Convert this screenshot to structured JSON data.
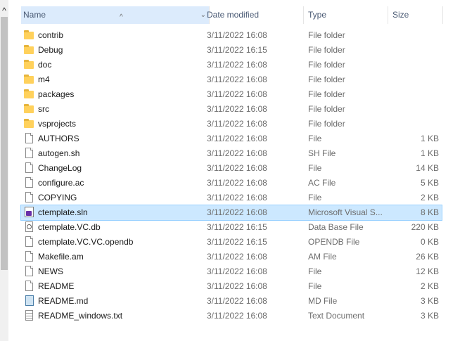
{
  "icons": {
    "scroll_up": "chevron-up-icon",
    "sort": "sort-ascending-icon",
    "column_menu": "chevron-down-icon"
  },
  "glyphs": {
    "scroll_up": "^",
    "sort": "^",
    "column_menu": "⌄"
  },
  "columns": {
    "name": "Name",
    "date": "Date modified",
    "type": "Type",
    "size": "Size"
  },
  "colors": {
    "header_active": "#dcebfc",
    "selected_row": "#cce8ff",
    "folder": "#ffd15c"
  },
  "files": [
    {
      "name": "contrib",
      "date": "3/11/2022 16:08",
      "type": "File folder",
      "size": "",
      "icon": "folder-icon"
    },
    {
      "name": "Debug",
      "date": "3/11/2022 16:15",
      "type": "File folder",
      "size": "",
      "icon": "folder-icon"
    },
    {
      "name": "doc",
      "date": "3/11/2022 16:08",
      "type": "File folder",
      "size": "",
      "icon": "folder-icon"
    },
    {
      "name": "m4",
      "date": "3/11/2022 16:08",
      "type": "File folder",
      "size": "",
      "icon": "folder-icon"
    },
    {
      "name": "packages",
      "date": "3/11/2022 16:08",
      "type": "File folder",
      "size": "",
      "icon": "folder-icon"
    },
    {
      "name": "src",
      "date": "3/11/2022 16:08",
      "type": "File folder",
      "size": "",
      "icon": "folder-icon"
    },
    {
      "name": "vsprojects",
      "date": "3/11/2022 16:08",
      "type": "File folder",
      "size": "",
      "icon": "folder-icon"
    },
    {
      "name": "AUTHORS",
      "date": "3/11/2022 16:08",
      "type": "File",
      "size": "1 KB",
      "icon": "file-icon"
    },
    {
      "name": "autogen.sh",
      "date": "3/11/2022 16:08",
      "type": "SH File",
      "size": "1 KB",
      "icon": "file-icon"
    },
    {
      "name": "ChangeLog",
      "date": "3/11/2022 16:08",
      "type": "File",
      "size": "14 KB",
      "icon": "file-icon"
    },
    {
      "name": "configure.ac",
      "date": "3/11/2022 16:08",
      "type": "AC File",
      "size": "5 KB",
      "icon": "file-icon"
    },
    {
      "name": "COPYING",
      "date": "3/11/2022 16:08",
      "type": "File",
      "size": "2 KB",
      "icon": "file-icon"
    },
    {
      "name": "ctemplate.sln",
      "date": "3/11/2022 16:08",
      "type": "Microsoft Visual S...",
      "size": "8 KB",
      "icon": "visual-studio-solution-icon",
      "selected": true
    },
    {
      "name": "ctemplate.VC.db",
      "date": "3/11/2022 16:15",
      "type": "Data Base File",
      "size": "220 KB",
      "icon": "database-file-icon"
    },
    {
      "name": "ctemplate.VC.VC.opendb",
      "date": "3/11/2022 16:15",
      "type": "OPENDB File",
      "size": "0 KB",
      "icon": "file-icon"
    },
    {
      "name": "Makefile.am",
      "date": "3/11/2022 16:08",
      "type": "AM File",
      "size": "26 KB",
      "icon": "file-icon"
    },
    {
      "name": "NEWS",
      "date": "3/11/2022 16:08",
      "type": "File",
      "size": "12 KB",
      "icon": "file-icon"
    },
    {
      "name": "README",
      "date": "3/11/2022 16:08",
      "type": "File",
      "size": "2 KB",
      "icon": "file-icon"
    },
    {
      "name": "README.md",
      "date": "3/11/2022 16:08",
      "type": "MD File",
      "size": "3 KB",
      "icon": "markdown-file-icon"
    },
    {
      "name": "README_windows.txt",
      "date": "3/11/2022 16:08",
      "type": "Text Document",
      "size": "3 KB",
      "icon": "text-document-icon"
    }
  ]
}
